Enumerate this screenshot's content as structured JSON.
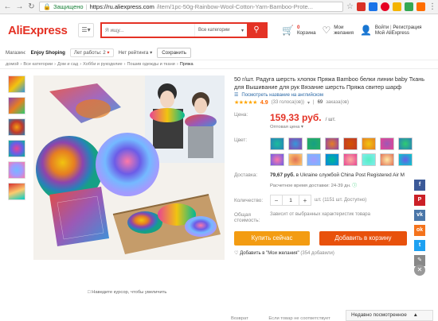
{
  "browser": {
    "secure_label": "Защищено",
    "url_host": "https://ru.aliexpress.com",
    "url_path": "/item/1pc-50g-Rainbow-Wool-Cotton-Yarn-Bamboo-Prote..."
  },
  "header": {
    "logo": "AliExpress",
    "search_placeholder": "Я ищу...",
    "search_category": "Все категории",
    "cart_count": "0",
    "cart_label": "Корзина",
    "wish_line1": "Мои",
    "wish_line2": "желания",
    "login": "Войти",
    "separator": "|",
    "register": "Регистрация",
    "my_aliexpress": "Мой AliExpress"
  },
  "store": {
    "prefix": "Магазин:",
    "name": "Enjoy Shoping",
    "years_label": "Лет работы: 2",
    "rating_label": "Нет рейтинга",
    "save_label": "Сохранить"
  },
  "breadcrumbs": [
    "домой",
    "Все категории",
    "Дом и сад",
    "Хобби и рукоделие",
    "Пошив одежды и ткани",
    "Пряжа"
  ],
  "product": {
    "title": "50 г/шт. Радуга шерсть хлопок Пряжа Bamboo белки линии baby Ткань для Вышивание для рук Вязание шерсть Пряжа свитер шарф",
    "english_link": "Посмотреть название на английском",
    "rating": "4.9",
    "votes": "(33 голоса(ов))",
    "orders_count": "69",
    "orders_label": "заказа(ов)",
    "price_label": "Цена:",
    "price": "159,33 руб.",
    "price_unit": "/ шт.",
    "wholesale": "Оптовая цена",
    "color_label": "Цвет:",
    "shipping_label": "Доставка:",
    "shipping_price": "79,67 руб.",
    "shipping_text": "в Ukraine службой China Post Registered Air M",
    "delivery_time": "Расчетное время доставки: 24-39 дн.",
    "qty_label": "Количество:",
    "qty_value": "1",
    "qty_minus": "−",
    "qty_plus": "+",
    "qty_note": "шт. (1151 шт. Доступно)",
    "total_label": "Общая стоимость:",
    "total_note": "Зависит от выбранных характеристик товара",
    "buy_now": "Купить сейчас",
    "add_to_cart": "Добавить в корзину",
    "wishlist_text": "Добавить в \"Мои желания\"",
    "wishlist_count": "(354 добавили)",
    "bottom_label": "Возврат",
    "bottom_text": "Если товар не соответствует"
  },
  "image_hint": "Наведите курсор, чтобы увеличить",
  "recent_label": "Недавно посмотренное",
  "colors": {
    "brand_red": "#e43225",
    "buy_orange": "#f39c12",
    "cart_orange": "#e8510c"
  }
}
